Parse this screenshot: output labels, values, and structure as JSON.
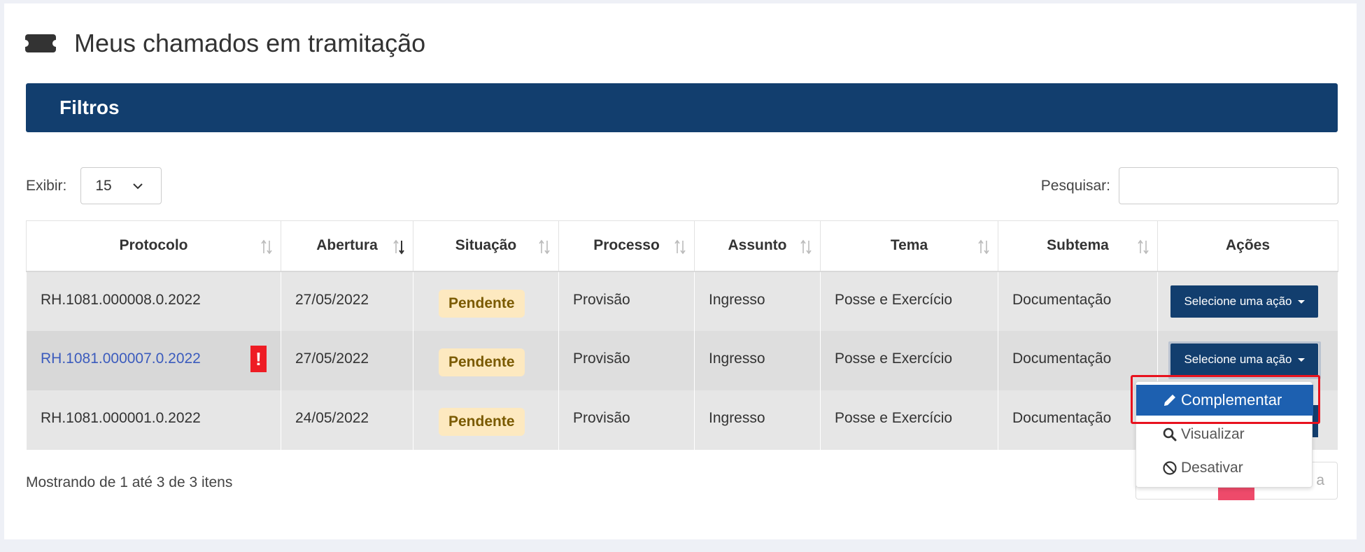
{
  "page": {
    "title": "Meus chamados em tramitação",
    "icon": "ticket-icon"
  },
  "filters": {
    "label": "Filtros"
  },
  "show": {
    "label": "Exibir:",
    "value": "15"
  },
  "search": {
    "label": "Pesquisar:",
    "value": ""
  },
  "table": {
    "headers": [
      "Protocolo",
      "Abertura",
      "Situação",
      "Processo",
      "Assunto",
      "Tema",
      "Subtema",
      "Ações"
    ],
    "rows": [
      {
        "protocolo": "RH.1081.000008.0.2022",
        "abertura": "27/05/2022",
        "situacao": "Pendente",
        "processo": "Provisão",
        "assunto": "Ingresso",
        "tema": "Posse e Exercício",
        "subtema": "Documentação",
        "acao": "Selecione uma ação"
      },
      {
        "protocolo": "RH.1081.000007.0.2022",
        "abertura": "27/05/2022",
        "situacao": "Pendente",
        "processo": "Provisão",
        "assunto": "Ingresso",
        "tema": "Posse e Exercício",
        "subtema": "Documentação",
        "acao": "Selecione uma ação",
        "alert": "!"
      },
      {
        "protocolo": "RH.1081.000001.0.2022",
        "abertura": "24/05/2022",
        "situacao": "Pendente",
        "processo": "Provisão",
        "assunto": "Ingresso",
        "tema": "Posse e Exercício",
        "subtema": "Documentação",
        "acao": ""
      }
    ]
  },
  "dropdown": {
    "items": [
      "Complementar",
      "Visualizar",
      "Desativar"
    ],
    "active": "Complementar"
  },
  "footer": {
    "info": "Mostrando de 1 até 3 de 3 itens",
    "pagination_partial": "a"
  },
  "colors": {
    "brand": "#123e6e",
    "active": "#1d60b0",
    "badge_bg": "#fde9c0",
    "alert": "#ee1c24",
    "highlight": "#e8121e"
  }
}
